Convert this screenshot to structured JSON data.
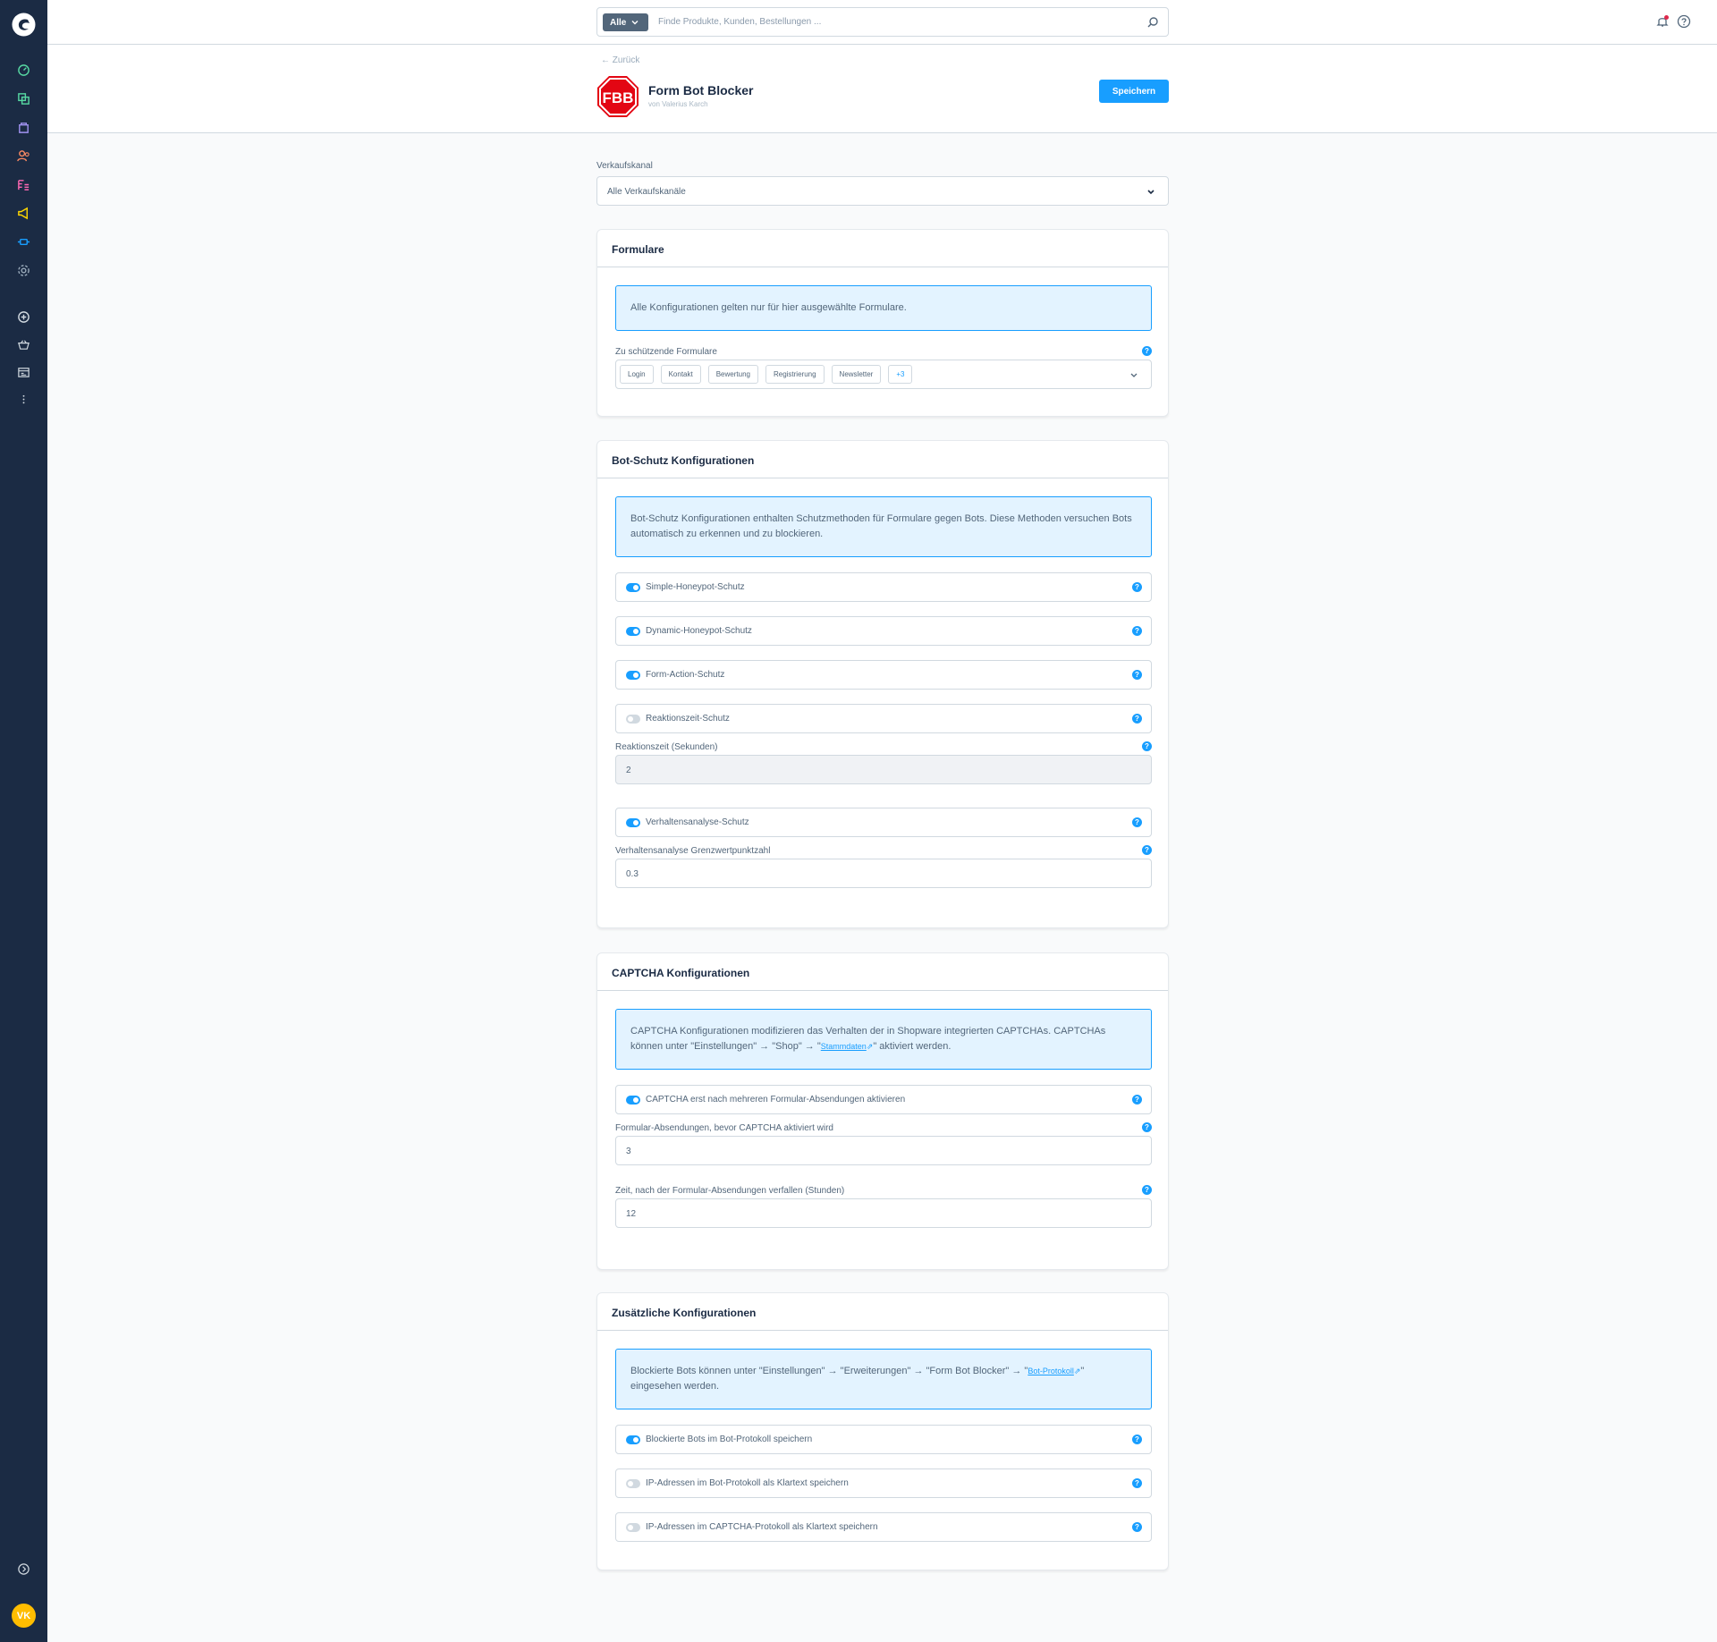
{
  "header": {
    "search_type": "Alle",
    "search_placeholder": "Finde Produkte, Kunden, Bestellungen ...",
    "back_label": "Zurück",
    "plugin_title": "Form Bot Blocker",
    "plugin_author": "von Valerius Karch",
    "plugin_logo_text": "FBB",
    "save_label": "Speichern"
  },
  "user": {
    "initials": "VK"
  },
  "saleschannel": {
    "label": "Verkaufskanal",
    "value": "Alle Verkaufskanäle"
  },
  "forms_card": {
    "title": "Formulare",
    "info": "Alle Konfigurationen gelten nur für hier ausgewählte Formulare.",
    "field_label": "Zu schützende Formulare",
    "tags": [
      "Login",
      "Kontakt",
      "Bewertung",
      "Registrierung",
      "Newsletter"
    ],
    "more": "+3"
  },
  "bot_card": {
    "title": "Bot-Schutz Konfigurationen",
    "info": "Bot-Schutz Konfigurationen enthalten Schutzmethoden für Formulare gegen Bots. Diese Methoden versuchen Bots automatisch zu erkennen und zu blockieren.",
    "toggles": [
      {
        "label": "Simple-Honeypot-Schutz",
        "on": true
      },
      {
        "label": "Dynamic-Honeypot-Schutz",
        "on": true
      },
      {
        "label": "Form-Action-Schutz",
        "on": true
      },
      {
        "label": "Reaktionszeit-Schutz",
        "on": false
      }
    ],
    "reaction_label": "Reaktionszeit (Sekunden)",
    "reaction_value": "2",
    "behavior_toggle": "Verhaltensanalyse-Schutz",
    "threshold_label": "Verhaltensanalyse Grenzwertpunktzahl",
    "threshold_value": "0.3"
  },
  "captcha_card": {
    "title": "CAPTCHA Konfigurationen",
    "info_1": "CAPTCHA Konfigurationen modifizieren das Verhalten der in Shopware integrierten CAPTCHAs. CAPTCHAs können unter \"Einstellungen\" → \"Shop\" → \"",
    "info_link": "Stammdaten",
    "info_2": "\" aktiviert werden.",
    "toggle": "CAPTCHA erst nach mehreren Formular-Absendungen aktivieren",
    "submissions_label": "Formular-Absendungen, bevor CAPTCHA aktiviert wird",
    "submissions_value": "3",
    "expiry_label": "Zeit, nach der Formular-Absendungen verfallen (Stunden)",
    "expiry_value": "12"
  },
  "extra_card": {
    "title": "Zusätzliche Konfigurationen",
    "info_1": "Blockierte Bots können unter \"Einstellungen\" → \"Erweiterungen\" → \"Form Bot Blocker\" → \"",
    "info_link": "Bot-Protokoll",
    "info_2": "\" eingesehen werden.",
    "toggles": [
      {
        "label": "Blockierte Bots im Bot-Protokoll speichern",
        "on": true
      },
      {
        "label": "IP-Adressen im Bot-Protokoll als Klartext speichern",
        "on": false
      },
      {
        "label": "IP-Adressen im CAPTCHA-Protokoll als Klartext speichern",
        "on": false
      }
    ]
  },
  "colors": {
    "primary": "#189eff",
    "sidebar": "#1b2b44",
    "info_bg": "#e3f3ff",
    "logo_red": "#e30613"
  },
  "icons": [
    "dashboard-icon",
    "catalogue-icon",
    "orders-icon",
    "customers-icon",
    "content-icon",
    "marketing-icon",
    "extensions-icon",
    "settings-icon",
    "add-icon",
    "basket-icon",
    "storefront-icon",
    "more-icon",
    "collapse-icon",
    "bell-icon",
    "help-icon",
    "search-icon"
  ]
}
